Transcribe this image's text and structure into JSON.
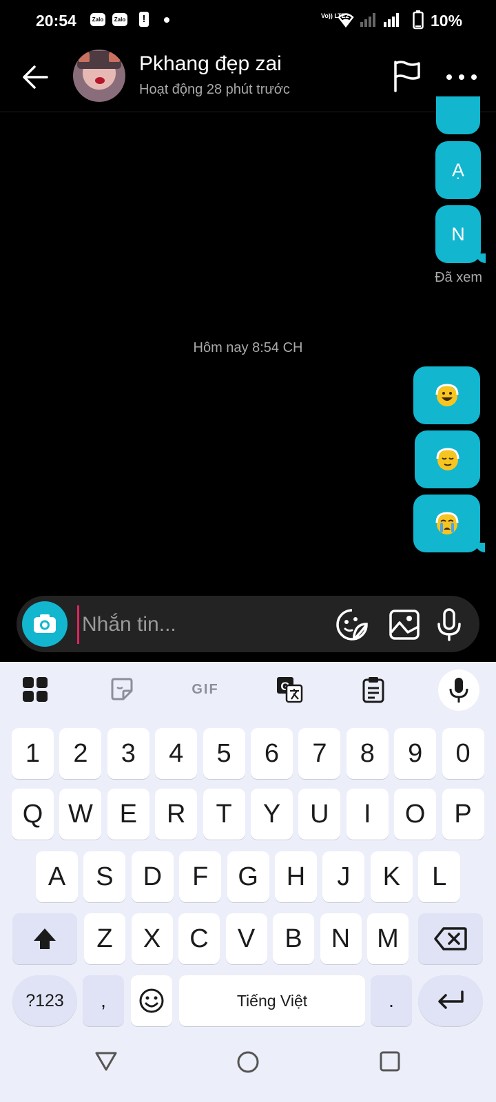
{
  "status_bar": {
    "time": "20:54",
    "battery": "10%",
    "notif_label": "Zalo",
    "alert_mark": "!",
    "volte": "Vo)) LTE2"
  },
  "header": {
    "name": "Pkhang đẹp zai",
    "status": "Hoạt động 28 phút trước"
  },
  "messages": {
    "letters": [
      "Ạ",
      "N"
    ],
    "seen": "Đã xem",
    "time_separator": "Hôm nay 8:54 CH",
    "emoji_icons": [
      "grinning-face-icon",
      "relieved-face-icon",
      "crying-face-icon"
    ]
  },
  "composer": {
    "placeholder": "Nhắn tin..."
  },
  "keyboard": {
    "toolbar_gif": "GIF",
    "row_numbers": [
      "1",
      "2",
      "3",
      "4",
      "5",
      "6",
      "7",
      "8",
      "9",
      "0"
    ],
    "row_q": [
      "Q",
      "W",
      "E",
      "R",
      "T",
      "Y",
      "U",
      "I",
      "O",
      "P"
    ],
    "row_a": [
      "A",
      "S",
      "D",
      "F",
      "G",
      "H",
      "J",
      "K",
      "L"
    ],
    "row_z": [
      "Z",
      "X",
      "C",
      "V",
      "B",
      "N",
      "M"
    ],
    "symbols_key": "?123",
    "comma_key": ",",
    "space_label": "Tiếng Việt",
    "period_key": "."
  },
  "colors": {
    "accent": "#12b6cf",
    "background": "#000000",
    "keyboard_bg": "#eceef9"
  }
}
